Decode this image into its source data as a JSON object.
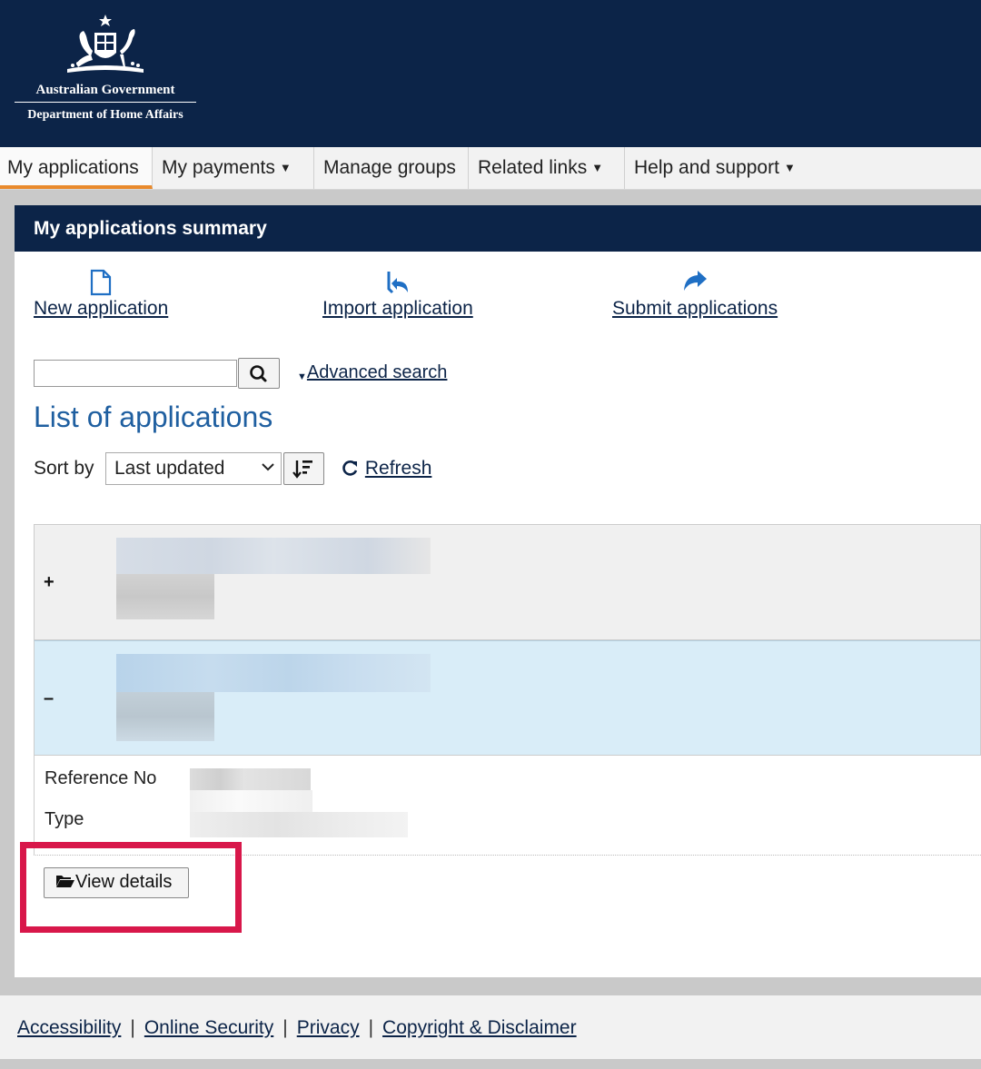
{
  "header": {
    "org_line1": "Australian Government",
    "org_line2": "Department of Home Affairs",
    "logo_icon": "coat-of-arms-icon"
  },
  "nav": {
    "items": [
      {
        "label": "My applications",
        "active": true
      },
      {
        "label": "My payments",
        "has_dropdown": true
      },
      {
        "label": "Manage groups"
      },
      {
        "label": "Related links",
        "has_dropdown": true
      },
      {
        "label": "Help and support",
        "has_dropdown": true
      }
    ]
  },
  "summary": {
    "title": "My applications summary",
    "actions": [
      {
        "label": "New application",
        "icon": "document-icon"
      },
      {
        "label": "Import application",
        "icon": "import-arrow-icon"
      },
      {
        "label": "Submit applications",
        "icon": "share-arrow-icon"
      }
    ]
  },
  "search": {
    "value": "",
    "button_icon": "search-icon",
    "advanced_label": "Advanced search"
  },
  "list": {
    "title": "List of applications",
    "sort_label": "Sort by",
    "sort_value": "Last updated",
    "refresh_label": "Refresh",
    "rows": [
      {
        "toggle": "+",
        "expanded": false
      },
      {
        "toggle": "–",
        "expanded": true
      }
    ],
    "details": {
      "reference_label": "Reference No",
      "type_label": "Type"
    },
    "view_details_label": "View details"
  },
  "footer": {
    "links": [
      "Accessibility",
      "Online Security",
      "Privacy",
      "Copyright & Disclaimer"
    ],
    "separator": "|"
  },
  "colors": {
    "navy": "#0c2448",
    "active_tab_underline": "#e98a2d",
    "expanded_row": "#d9edf8",
    "highlight": "#d8174a",
    "heading_blue": "#1f5fa0"
  }
}
